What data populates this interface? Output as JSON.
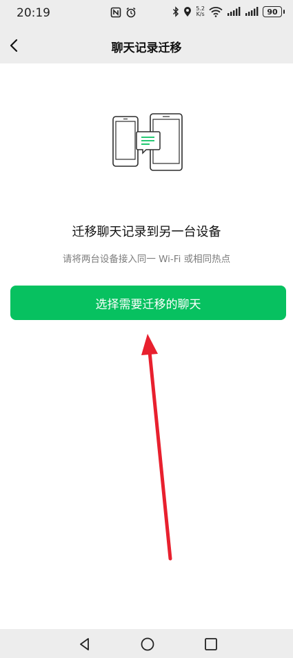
{
  "status_bar": {
    "time": "20:19",
    "net_speed_value": "5.2",
    "net_speed_unit": "K/s",
    "battery": "90",
    "icons": [
      "nfc-icon",
      "alarm-icon",
      "bluetooth-icon",
      "location-icon",
      "wifi-icon",
      "signal-icon",
      "signal-icon-2",
      "battery-icon"
    ]
  },
  "header": {
    "title": "聊天记录迁移",
    "back_icon": "chevron-left-icon"
  },
  "main": {
    "illustration_icon": "phones-transfer-icon",
    "heading": "迁移聊天记录到另一台设备",
    "subtext": "请将两台设备接入同一 Wi-Fi 或相同热点",
    "primary_button": "选择需要迁移的聊天"
  },
  "nav_bar": {
    "icons": [
      "back-triangle-icon",
      "home-circle-icon",
      "recents-square-icon"
    ]
  },
  "colors": {
    "accent": "#07c160",
    "annotation": "#e8202e",
    "bar_background": "#ededed",
    "secondary_text": "#7d7d7d"
  }
}
